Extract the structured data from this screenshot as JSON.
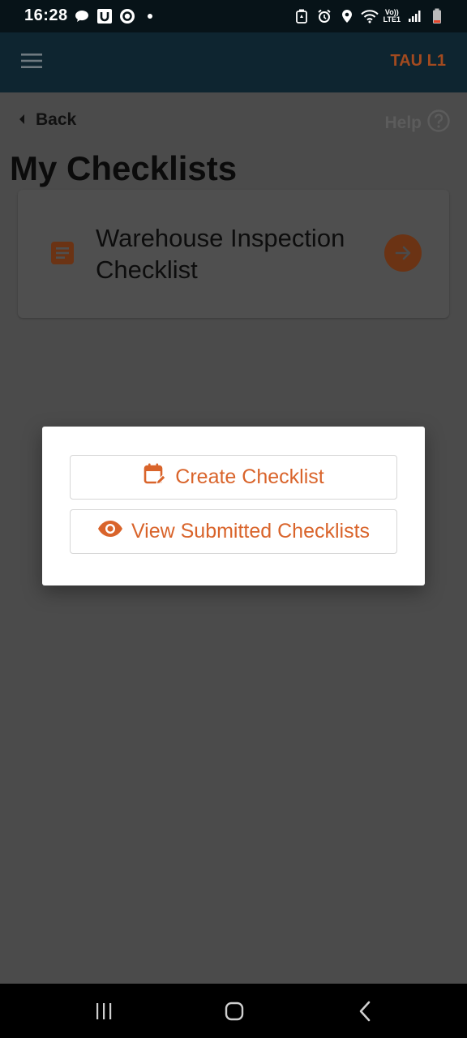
{
  "status_bar": {
    "time": "16:28",
    "left_icons": [
      "chat-bubble-icon",
      "u-app-icon",
      "o-app-icon",
      "notification-dot"
    ],
    "right_icons": [
      "battery-saver-icon",
      "alarm-icon",
      "location-icon",
      "wifi-icon",
      "lte-icon",
      "signal-icon",
      "battery-icon"
    ],
    "lte_top": "Vo))",
    "lte_bottom": "LTE1"
  },
  "app_bar": {
    "title": "TAU L1"
  },
  "nav": {
    "back_label": "Back",
    "help_label": "Help"
  },
  "page": {
    "title": "My Checklists"
  },
  "checklists": [
    {
      "title": "Warehouse Inspection Checklist"
    }
  ],
  "modal": {
    "create_label": "Create Checklist",
    "view_label": "View Submitted Checklists"
  },
  "colors": {
    "accent": "#d9642b",
    "app_bar": "#0e2530",
    "overlay": "#4b4b4b"
  }
}
